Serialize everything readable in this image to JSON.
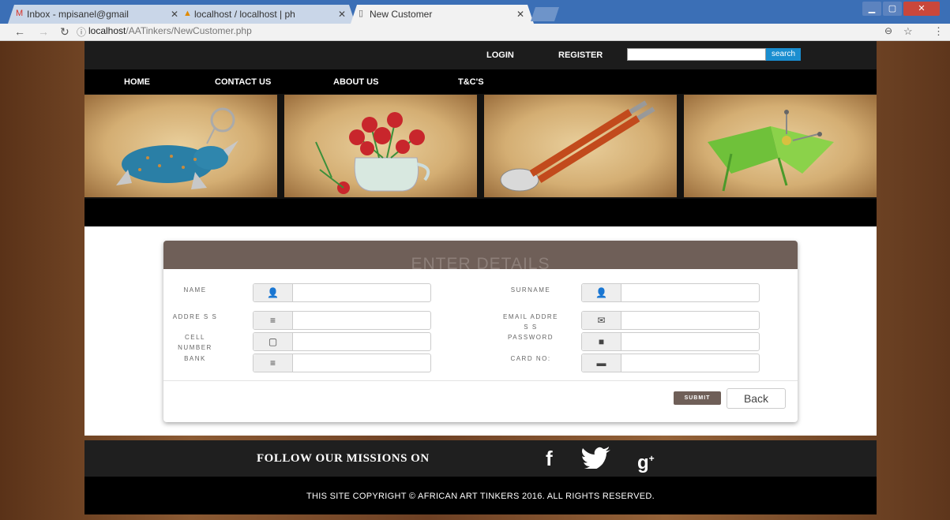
{
  "browser": {
    "tabs": [
      {
        "title": "Inbox - mpisanel@gmail",
        "icon": "gmail-icon"
      },
      {
        "title": "localhost / localhost | ph",
        "icon": "phpmyadmin-icon"
      },
      {
        "title": "New Customer",
        "icon": "page-icon"
      }
    ],
    "url_host": "localhost",
    "url_path": "/AATinkers/NewCustomer.php"
  },
  "header": {
    "login": "LOGIN",
    "register": "REGISTER",
    "search_button": "search"
  },
  "nav": [
    "HOME",
    "CONTACT US",
    "ABOUT US",
    "T&C'S"
  ],
  "form": {
    "title": "ENTER DETAILS",
    "name_label": "NAME",
    "surname_label": "SURNAME",
    "address_label": "ADDRE S S",
    "email_label": "EMAIL ADDRE S S",
    "cell_label": "CELL NUMBER",
    "password_label": "PASSWORD",
    "bank_label": "BANK",
    "card_label": "CARD NO:",
    "submit": "SUBMIT",
    "back": "Back"
  },
  "footer": {
    "follow": "FOLLOW OUR MISSIONS ON",
    "social": [
      "facebook-icon",
      "twitter-icon",
      "google-plus-icon"
    ],
    "copyright": "THIS SITE COPYRIGHT © AFRICAN ART TINKERS 2016. ALL RIGHTS RESERVED."
  },
  "colors": {
    "panel_header": "#6f5f58",
    "search_button": "#1a8ed0",
    "chrome_blue": "#3b6fb6"
  }
}
